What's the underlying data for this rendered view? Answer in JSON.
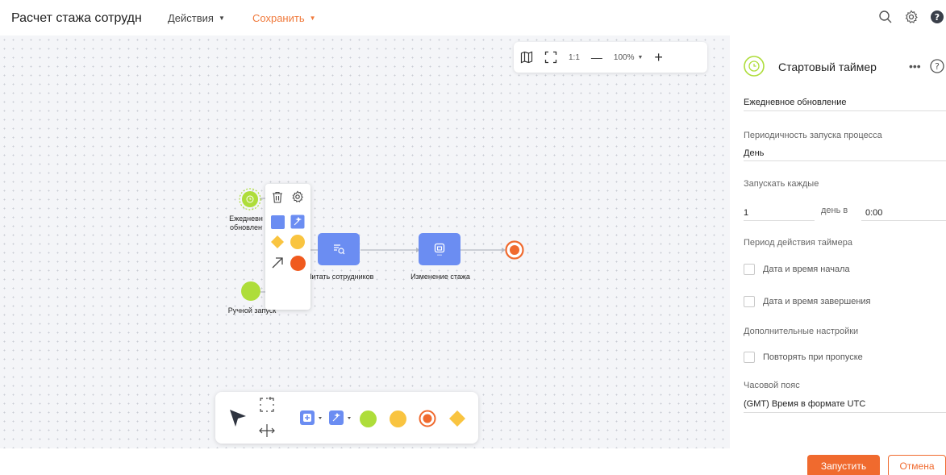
{
  "header": {
    "title": "Расчет стажа сотрудн",
    "actions_menu": "Действия",
    "save_menu": "Сохранить"
  },
  "zoombar": {
    "one_to_one": "1:1",
    "zoom_level": "100%",
    "zoom_out": "—",
    "zoom_in": "+"
  },
  "diagram": {
    "timer_node_label": "Ежедневн обновлен",
    "manual_start_label": "Ручной запуск",
    "read_task_label": "Читать сотрудников",
    "change_task_label": "Изменение стажа",
    "node_colors": {
      "timer": "#aedd3a",
      "task": "#6b8df2",
      "end": "#f06a2e",
      "yellow": "#f9c440"
    }
  },
  "panel": {
    "title": "Стартовый таймер",
    "name_value": "Ежедневное обновление",
    "periodicity_label": "Периодичность запуска процесса",
    "periodicity_value": "День",
    "every_label": "Запускать каждые",
    "every_value": "1",
    "day_at": "день в",
    "time_value": "0:00",
    "period_label": "Период действия таймера",
    "start_datetime": "Дата и время начала",
    "end_datetime": "Дата и время завершения",
    "extra_label": "Дополнительные настройки",
    "repeat_missed": "Повторять при пропуске",
    "timezone_label": "Часовой пояс",
    "timezone_value": "(GMT) Время в формате UTC"
  },
  "footer": {
    "run_button": "Запустить",
    "cancel_button": "Отмена"
  }
}
